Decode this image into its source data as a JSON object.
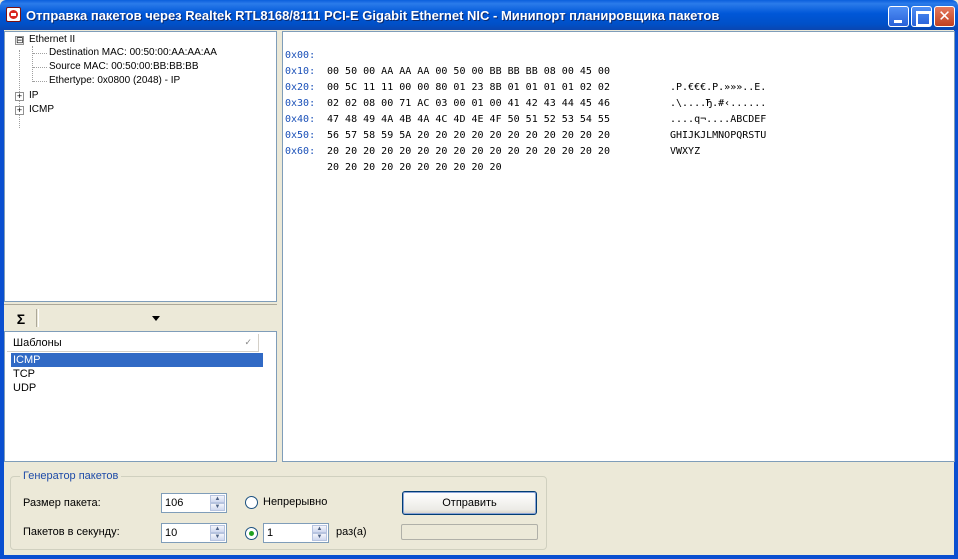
{
  "window": {
    "title": "Отправка пакетов через  Realtek RTL8168/8111 PCI-E Gigabit Ethernet NIC - Минипорт планировщика пакетов",
    "minimize_icon": "minimize-icon",
    "maximize_icon": "maximize-icon",
    "close_icon": "close-icon",
    "close_glyph": "✕"
  },
  "tree": {
    "root": {
      "label": "Ethernet II",
      "expander": "⊟"
    },
    "children": [
      {
        "label": "Destination MAC: 00:50:00:AA:AA:AA"
      },
      {
        "label": "Source MAC: 00:50:00:BB:BB:BB"
      },
      {
        "label": "Ethertype: 0x0800 (2048) - IP"
      }
    ],
    "collapsed": [
      {
        "label": "IP",
        "expander": "+"
      },
      {
        "label": "ICMP",
        "expander": "+"
      }
    ]
  },
  "toolbar": {
    "sigma_glyph": "Σ",
    "dropdown_value": ""
  },
  "templates": {
    "header": "Шаблоны",
    "sort_glyph": "✓",
    "items": [
      "ICMP",
      "TCP",
      "UDP"
    ],
    "selected": "ICMP"
  },
  "hex": {
    "rows": [
      {
        "offset": "0x00:",
        "bytes": "00 50 00 AA AA AA 00 50 00 BB BB BB 08 00 45 00",
        "ascii": ".P.€€€.P.»»»..E."
      },
      {
        "offset": "0x10:",
        "bytes": "00 5C 11 11 00 00 80 01 23 8B 01 01 01 01 02 02",
        "ascii": ".\\....Ђ.#‹......"
      },
      {
        "offset": "0x20:",
        "bytes": "02 02 08 00 71 AC 03 00 01 00 41 42 43 44 45 46",
        "ascii": "....q¬....ABCDEF"
      },
      {
        "offset": "0x30:",
        "bytes": "47 48 49 4A 4B 4A 4C 4D 4E 4F 50 51 52 53 54 55",
        "ascii": "GHIJKJLMNOPQRSTU"
      },
      {
        "offset": "0x40:",
        "bytes": "56 57 58 59 5A 20 20 20 20 20 20 20 20 20 20 20",
        "ascii": "VWXYZ"
      },
      {
        "offset": "0x50:",
        "bytes": "20 20 20 20 20 20 20 20 20 20 20 20 20 20 20 20",
        "ascii": ""
      },
      {
        "offset": "0x60:",
        "bytes": "20 20 20 20 20 20 20 20 20 20",
        "ascii": ""
      }
    ]
  },
  "generator": {
    "legend": "Генератор пакетов",
    "packet_size_label": "Размер пакета:",
    "packet_size_value": "106",
    "pps_label": "Пакетов в секунду:",
    "pps_value": "10",
    "continuous_label": "Непрерывно",
    "count_value": "1",
    "times_label": "раз(а)",
    "send_label": "Отправить",
    "progress": 0,
    "spin_up": "▲",
    "spin_down": "▼"
  }
}
